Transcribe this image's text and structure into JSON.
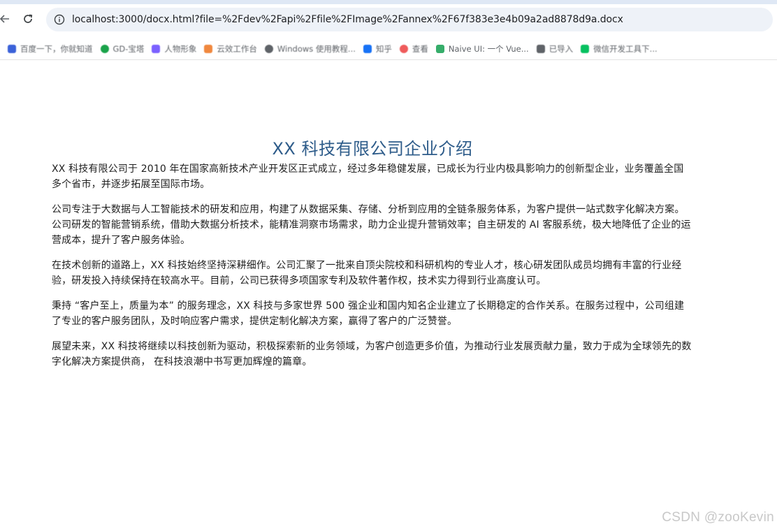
{
  "browser": {
    "url": "localhost:3000/docx.html?file=%2Fdev%2Fapi%2Ffile%2FImage%2Fannex%2F67f383e3e4b09a2ad8878d9a.docx",
    "icons": [
      "back-arrow-icon",
      "reload-icon",
      "site-info-icon"
    ]
  },
  "bookmarks": [
    {
      "label": "百度一下，你就知道",
      "color": "#3b62d9"
    },
    {
      "label": "GD-宝塔",
      "color": "#1aa34a"
    },
    {
      "label": "人物形象",
      "color": "#7b61ff"
    },
    {
      "label": "云效工作台",
      "color": "#f0883e"
    },
    {
      "label": "Windows 使用教程...",
      "color": "#5f6368"
    },
    {
      "label": "知乎",
      "color": "#1772f6"
    },
    {
      "label": "查看",
      "color": "#ef5b5b"
    },
    {
      "label": "Naive UI: 一个 Vue...",
      "color": "#36ad6a"
    },
    {
      "label": "已导入",
      "color": "#5f6368"
    },
    {
      "label": "微信开发工具下...",
      "color": "#07c160"
    }
  ],
  "document": {
    "title": "XX 科技有限公司企业介绍",
    "paragraphs": [
      "XX 科技有限公司于 2010 年在国家高新技术产业开发区正式成立，经过多年稳健发展，已成长为行业内极具影响力的创新型企业，业务覆盖全国多个省市，并逐步拓展至国际市场。",
      "公司专注于大数据与人工智能技术的研发和应用，构建了从数据采集、存储、分析到应用的全链条服务体系，为客户提供一站式数字化解决方案。公司研发的智能营销系统，借助大数据分析技术，能精准洞察市场需求，助力企业提升营销效率；自主研发的 AI 客服系统，极大地降低了企业的运营成本，提升了客户服务体验。",
      "在技术创新的道路上，XX 科技始终坚持深耕细作。公司汇聚了一批来自顶尖院校和科研机构的专业人才，核心研发团队成员均拥有丰富的行业经验，研发投入持续保持在较高水平。目前，公司已获得多项国家专利及软件著作权，技术实力得到行业高度认可。",
      "秉持 “客户至上，质量为本” 的服务理念，XX 科技与多家世界 500 强企业和国内知名企业建立了长期稳定的合作关系。在服务过程中，公司组建了专业的客户服务团队，及时响应客户需求，提供定制化解决方案，赢得了客户的广泛赞誉。",
      "展望未来，XX 科技将继续以科技创新为驱动，积极探索新的业务领域，为客户创造更多价值，为推动行业发展贡献力量，致力于成为全球领先的数字化解决方案提供商， 在科技浪潮中书写更加辉煌的篇章。"
    ]
  },
  "watermark": "CSDN @zooKevin"
}
